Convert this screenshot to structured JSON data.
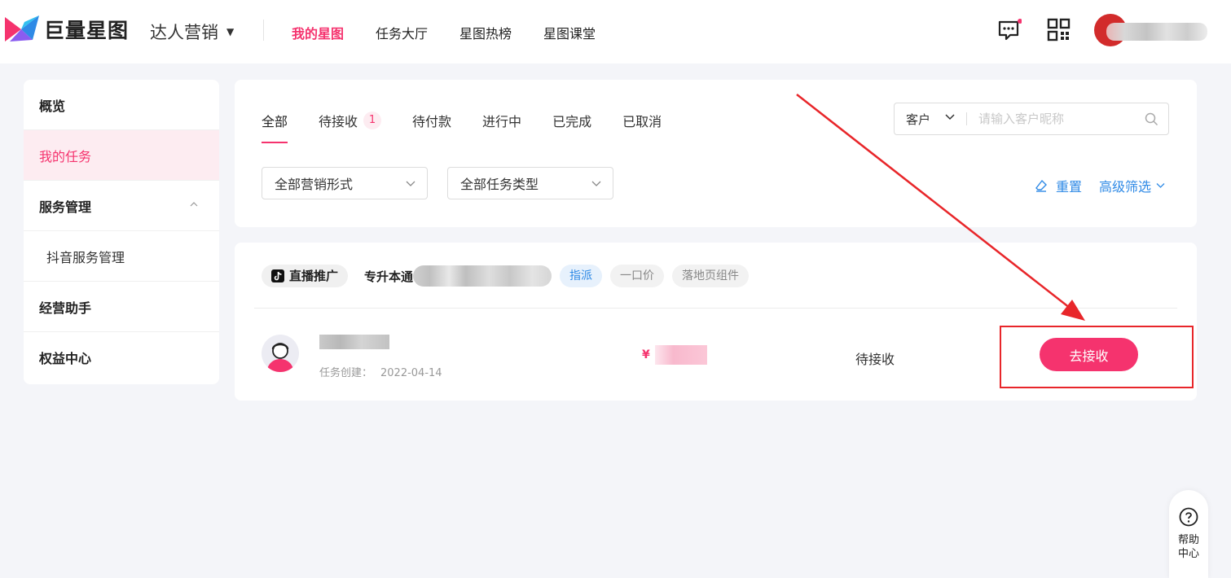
{
  "header": {
    "logo_text": "巨量星图",
    "product": "达人营销",
    "nav": [
      {
        "label": "我的星图",
        "active": true
      },
      {
        "label": "任务大厅",
        "active": false
      },
      {
        "label": "星图热榜",
        "active": false
      },
      {
        "label": "星图课堂",
        "active": false
      }
    ],
    "icons": [
      "message-icon",
      "qr-code-icon"
    ],
    "colors": {
      "accent": "#f5336e",
      "link": "#2f8ae6"
    }
  },
  "sidebar": {
    "items": [
      {
        "label": "概览"
      },
      {
        "label": "我的任务"
      },
      {
        "label": "服务管理"
      },
      {
        "label": "抖音服务管理"
      },
      {
        "label": "经营助手"
      },
      {
        "label": "权益中心"
      }
    ]
  },
  "filters": {
    "tabs": [
      {
        "label": "全部"
      },
      {
        "label": "待接收",
        "count": "1"
      },
      {
        "label": "待付款"
      },
      {
        "label": "进行中"
      },
      {
        "label": "已完成"
      },
      {
        "label": "已取消"
      }
    ],
    "search": {
      "scope": "客户",
      "placeholder": "请输入客户昵称"
    },
    "selects": {
      "marketing_form": "全部营销形式",
      "task_type": "全部任务类型"
    },
    "reset_label": "重置",
    "advanced_label": "高级筛选"
  },
  "task": {
    "platform": "直播推广",
    "name_prefix": "专升本通",
    "tags": [
      "指派",
      "一口价",
      "落地页组件"
    ],
    "created_label": "任务创建：",
    "created_date": "2022-04-14",
    "currency": "¥",
    "status": "待接收",
    "action_label": "去接收"
  },
  "help": {
    "label": "帮助中心"
  }
}
